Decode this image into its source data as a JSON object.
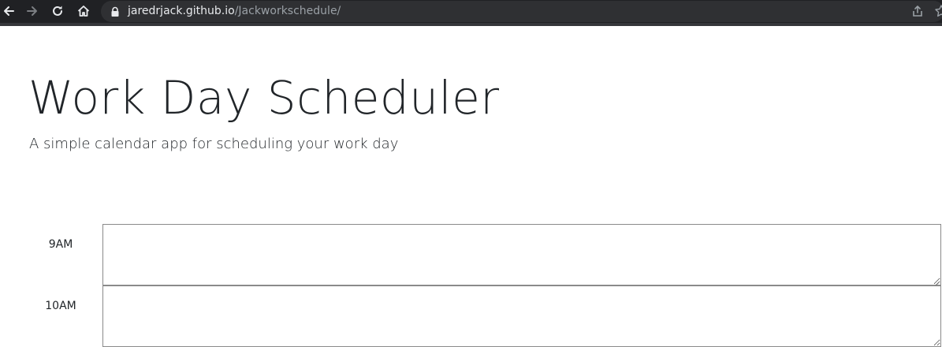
{
  "browser": {
    "url_host": "jaredrjack.github.io",
    "url_path": "/Jackworkschedule/",
    "icons": [
      "back-arrow-icon",
      "forward-arrow-icon",
      "reload-icon",
      "home-icon",
      "lock-icon",
      "share-icon",
      "bookmark-star-icon"
    ]
  },
  "header": {
    "title": "Work Day Scheduler",
    "subtitle": "A simple calendar app for scheduling your work day"
  },
  "schedule": {
    "rows": [
      {
        "hour": "9AM",
        "text": ""
      },
      {
        "hour": "10AM",
        "text": ""
      }
    ]
  },
  "colors": {
    "toolbar_bg": "#202124",
    "omnibox_bg": "#2f3033",
    "text": "#212529",
    "textarea_border": "#8a8a8a"
  }
}
